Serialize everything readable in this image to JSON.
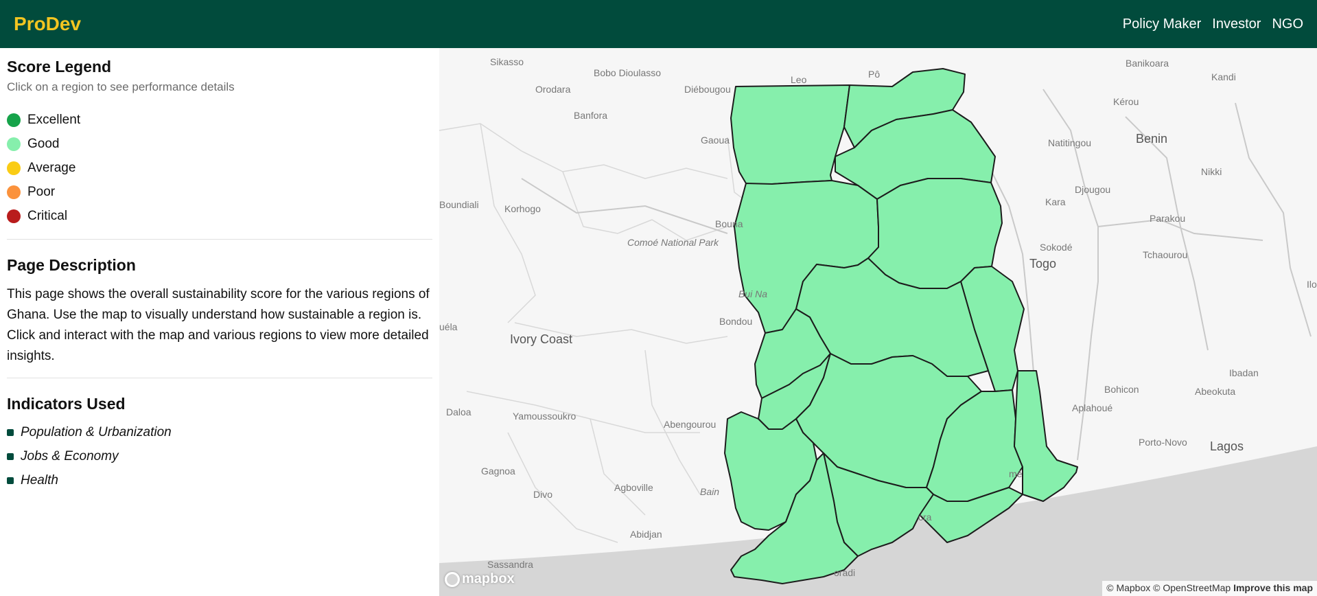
{
  "navbar": {
    "brand": "ProDev",
    "links": [
      "Policy Maker",
      "Investor",
      "NGO"
    ]
  },
  "legend": {
    "title": "Score Legend",
    "subtitle": "Click on a region to see performance details",
    "items": [
      {
        "label": "Excellent",
        "color": "#16a34a"
      },
      {
        "label": "Good",
        "color": "#86efac"
      },
      {
        "label": "Average",
        "color": "#facc15"
      },
      {
        "label": "Poor",
        "color": "#fb923c"
      },
      {
        "label": "Critical",
        "color": "#b91c1c"
      }
    ]
  },
  "description": {
    "title": "Page Description",
    "text": "This page shows the overall sustainability score for the various regions of Ghana. Use the map to visually understand how sustainable a region is. Click and interact with the map and various regions to view more detailed insights."
  },
  "indicators": {
    "title": "Indicators Used",
    "items": [
      "Population & Urbanization",
      "Jobs & Economy",
      "Health"
    ]
  },
  "map": {
    "region_fill": "#86efac",
    "labels": [
      "Sikasso",
      "Bobo Dioulasso",
      "Orodara",
      "Diébougou",
      "Leo",
      "Pô",
      "Banikoara",
      "Kandi",
      "Kérou",
      "Banfora",
      "Gaoua",
      "Natitingou",
      "Benin",
      "Nikki",
      "Djougou",
      "Kara",
      "Boundiali",
      "Korhogo",
      "Bouna",
      "Comoé National Park",
      "Parakou",
      "Sokodé",
      "Togo",
      "Tchaourou",
      "Bui Na",
      "Bondou",
      "Ivory Coast",
      "uéla",
      "Ibadan",
      "Bohicon",
      "Abeokuta",
      "Daloa",
      "Yamoussoukro",
      "Abengourou",
      "Aplahoué",
      "Porto-Novo",
      "Lagos",
      "Gagnoa",
      "Divo",
      "Agboville",
      "Bain",
      "Abidjan",
      "Sassandra",
      "Ilo",
      "mé",
      "cra",
      "oradi"
    ],
    "logo": "mapbox",
    "attribution": "© Mapbox © OpenStreetMap",
    "improve_link": "Improve this map"
  }
}
